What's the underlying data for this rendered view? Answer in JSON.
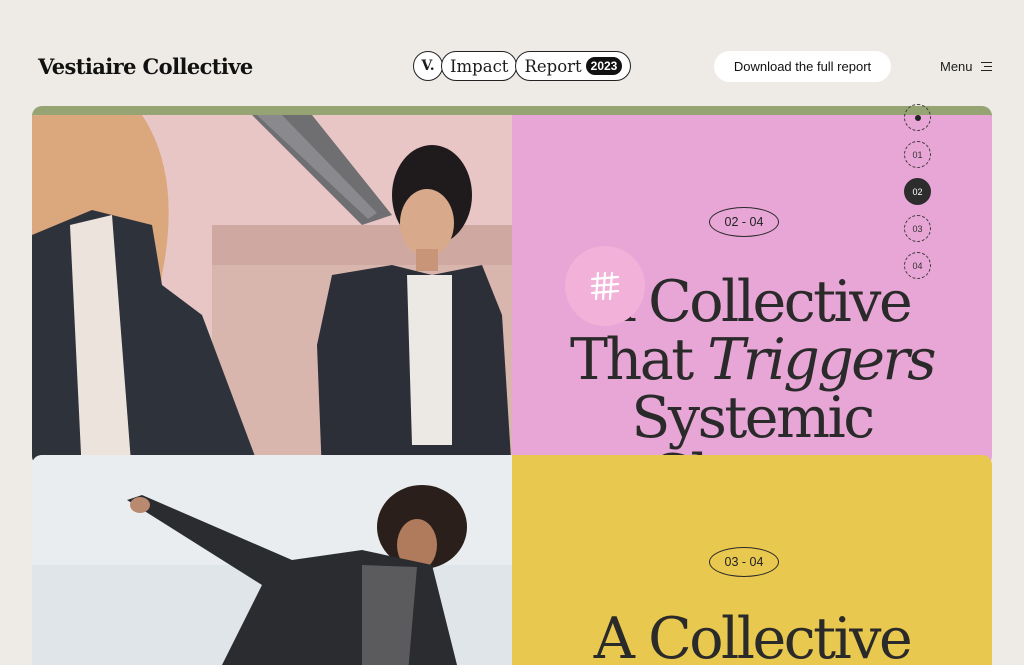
{
  "header": {
    "logo": "Vestiaire Collective",
    "badge": {
      "v": "V.",
      "word1": "Impact",
      "word2": "Report",
      "year": "2023"
    },
    "download_label": "Download the full report",
    "menu_label": "Menu"
  },
  "section1": {
    "step": "02 - 04",
    "headline": {
      "line1": "A Collective",
      "line2_a": "That ",
      "line2_b": "Triggers",
      "line3": "Systemic",
      "line4": "Change"
    },
    "panel_color": "#e8a6d6"
  },
  "section2": {
    "step": "03 - 04",
    "headline": {
      "line1": "A Collective"
    },
    "panel_color": "#e8c84e"
  },
  "nav_dots": [
    "01",
    "02",
    "03",
    "04"
  ],
  "accent_colors": {
    "olive": "#96a474",
    "pink": "#e8a6d6",
    "yellow": "#e8c84e",
    "background": "#eeebe6"
  }
}
